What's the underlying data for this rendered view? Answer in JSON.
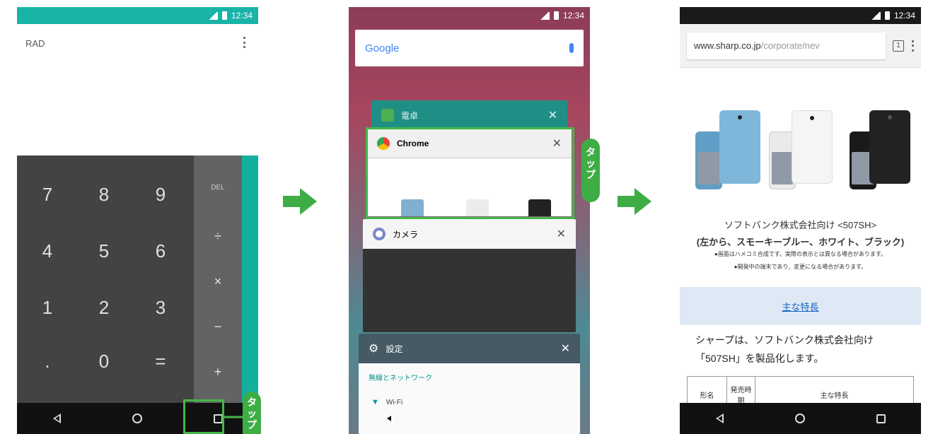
{
  "status": {
    "time": "12:34"
  },
  "calc": {
    "mode": "RAD",
    "keys": [
      "7",
      "8",
      "9",
      "4",
      "5",
      "6",
      "1",
      "2",
      "3",
      ".",
      "0",
      "="
    ],
    "ops": [
      "DEL",
      "÷",
      "×",
      "−",
      "+"
    ]
  },
  "tap_label": "タップ",
  "recents": {
    "search_logo": "Google",
    "cards": [
      {
        "title": "電卓",
        "icon": "calculator-icon"
      },
      {
        "title": "Chrome",
        "icon": "chrome-icon"
      },
      {
        "title": "カメラ",
        "icon": "camera-icon"
      },
      {
        "title": "設定",
        "icon": "settings-icon"
      }
    ],
    "settings_section": "無線とネットワーク",
    "wifi_label": "Wi-Fi",
    "close_glyph": "✕"
  },
  "chrome": {
    "url_host": "www.sharp.co.jp",
    "url_path": "/corporate/nev",
    "tab_count": "1",
    "caption_lines": [
      "ソフトバンク株式会社向け <507SH>",
      "(左から、スモーキーブルー、ホワイト、ブラック)",
      "●画面はハメコミ合成です。実際の表示とは異なる場合があります。",
      "●開発中の端末であり、変更になる場合があります。"
    ],
    "features_link": "主な特長",
    "body_line1": "シャープは、ソフトバンク株式会社向け",
    "body_line2": "「507SH」を製品化します。",
    "table_headers": [
      "形名",
      "発売時期",
      "主な特長"
    ]
  },
  "colors": {
    "accent_green": "#3fad46",
    "calc_teal": "#19b3a8"
  }
}
